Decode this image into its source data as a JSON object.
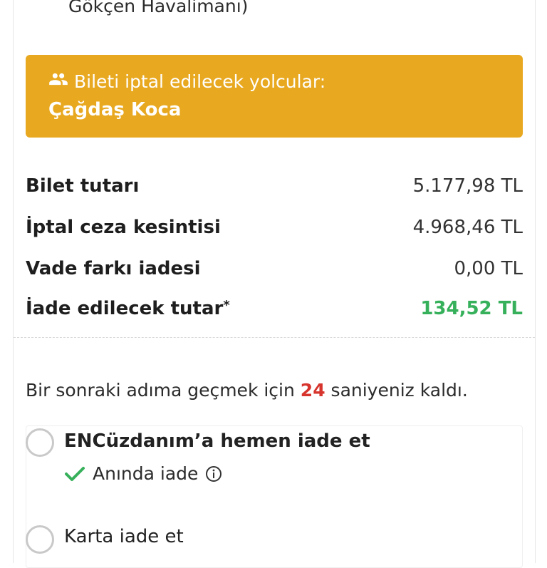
{
  "header": {
    "airport_line": "Gökçen Havalimanı)"
  },
  "cancellation": {
    "title": "Bileti iptal edilecek yolcular:",
    "passenger": "Çağdaş Koca",
    "icon": "people-icon",
    "banner_color": "#e8a81f"
  },
  "summary": {
    "ticket_label": "Bilet tutarı",
    "ticket_value": "5.177,98 TL",
    "penalty_label": "İptal ceza kesintisi",
    "penalty_value": "4.968,46 TL",
    "maturity_label": "Vade farkı iadesi",
    "maturity_value": "0,00 TL",
    "refund_label": "İade edilecek tutar",
    "refund_asterisk": "*",
    "refund_value": "134,52 TL",
    "refund_color": "#36b05a"
  },
  "countdown": {
    "prefix": "Bir sonraki adıma geçmek için ",
    "seconds": "24",
    "suffix": " saniyeniz kaldı.",
    "seconds_color": "#d6342c"
  },
  "options": {
    "wallet_label": "ENCüzdanım’a hemen iade et",
    "wallet_sub": "Anında iade",
    "card_label": "Karta iade et",
    "check_icon": "check-icon",
    "info_icon": "info-icon"
  }
}
